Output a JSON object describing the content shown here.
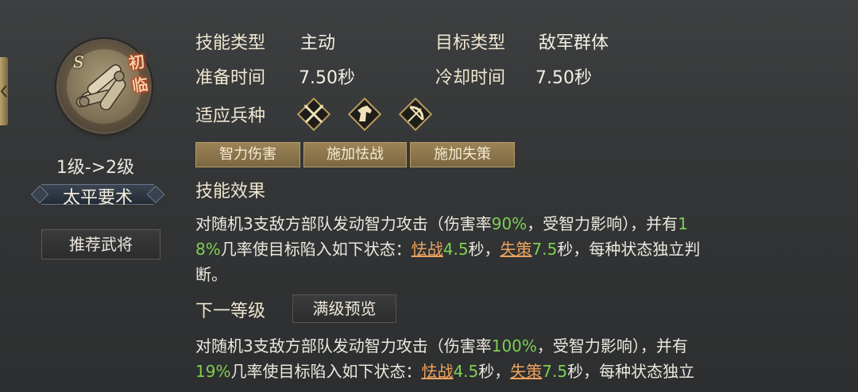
{
  "skill": {
    "grade": "S",
    "badge": "初临",
    "level_change": "1级->2级",
    "name": "太平要术",
    "recommend_label": "推荐武将"
  },
  "info": {
    "skill_type_label": "技能类型",
    "skill_type_value": "主动",
    "target_type_label": "目标类型",
    "target_type_value": "敌军群体",
    "prep_time_label": "准备时间",
    "prep_time_value": "7.50秒",
    "cooldown_label": "冷却时间",
    "cooldown_value": "7.50秒",
    "troop_label": "适应兵种",
    "troop_icons": [
      "spear-infantry-icon",
      "cavalry-horse-icon",
      "archer-bow-icon"
    ]
  },
  "tags": [
    "智力伤害",
    "施加怯战",
    "施加失策"
  ],
  "effect": {
    "title": "技能效果",
    "l1_a": "对随机3支敌方部队发动智力攻击（伤害率",
    "l1_rate": "90%",
    "l1_b": "，受智力影响），并有",
    "l1_chance_a": "1",
    "l2_chance_b": "8%",
    "l2_a": "几率使目标陷入如下状态：",
    "status1": "怯战",
    "status1_time": "4.5",
    "sec_a": "秒，",
    "status2": "失策",
    "status2_time": "7.5",
    "l2_b": "秒，每种状态独立判",
    "l3": "断。"
  },
  "next": {
    "title": "下一等级",
    "full_preview_label": "满级预览",
    "l1_a": "对随机3支敌方部队发动智力攻击（伤害率",
    "l1_rate": "100%",
    "l1_b": "，受智力影响），并有",
    "l2_chance": "19%",
    "l2_a": "几率使目标陷入如下状态：",
    "status1": "怯战",
    "status1_time": "4.5",
    "sec_a": "秒，",
    "status2": "失策",
    "status2_time": "7.5",
    "l2_b": "秒，每种状态独立"
  },
  "colors": {
    "highlight_green": "#7fcf52",
    "status_orange": "#f0a35c",
    "tag_gold": "#9c8356"
  }
}
